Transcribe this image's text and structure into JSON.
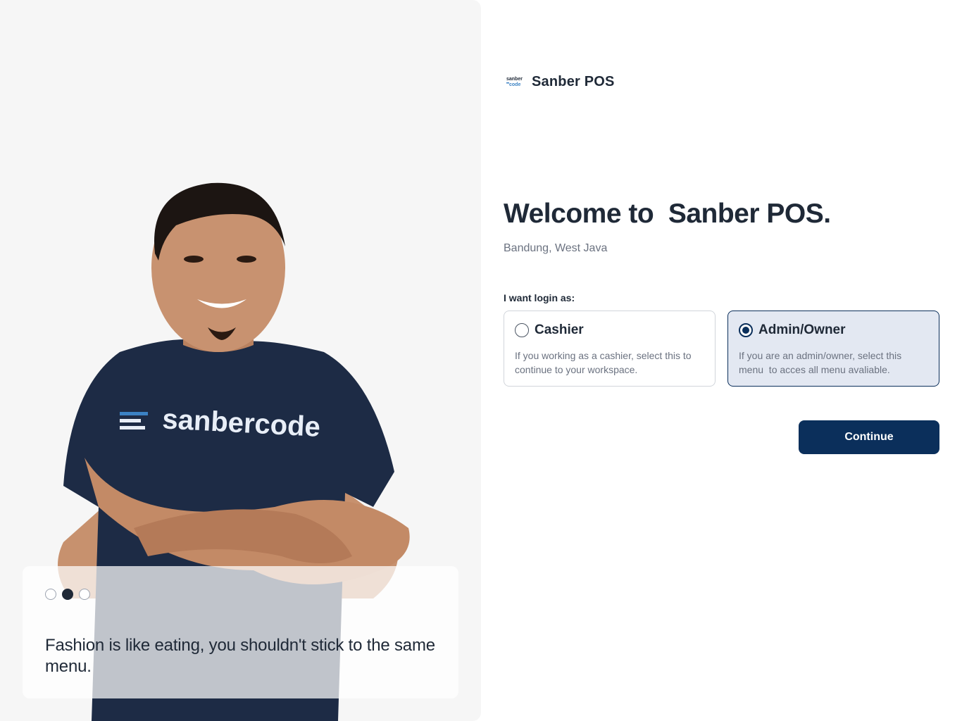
{
  "hero": {
    "shirt_text": "sanbercode",
    "carousel": {
      "count": 3,
      "active_index": 1
    },
    "quote": "Fashion is like eating, you shouldn't stick to the same menu."
  },
  "brand": {
    "logo_text": "sanber code",
    "name": "Sanber POS"
  },
  "welcome": {
    "title": "Welcome to  Sanber POS.",
    "location": "Bandung, West Java"
  },
  "login": {
    "label": "I want login as:",
    "options": [
      {
        "title": "Cashier",
        "description": "If you working as a cashier, select this to continue to your workspace.",
        "selected": false
      },
      {
        "title": "Admin/Owner",
        "description": "If you are an admin/owner, select this menu  to acces all menu avaliable.",
        "selected": true
      }
    ]
  },
  "actions": {
    "continue_label": "Continue"
  },
  "colors": {
    "primary": "#0b2f5b",
    "selected_bg": "#e3e8f2",
    "text": "#1f2937",
    "muted": "#6b7280"
  }
}
